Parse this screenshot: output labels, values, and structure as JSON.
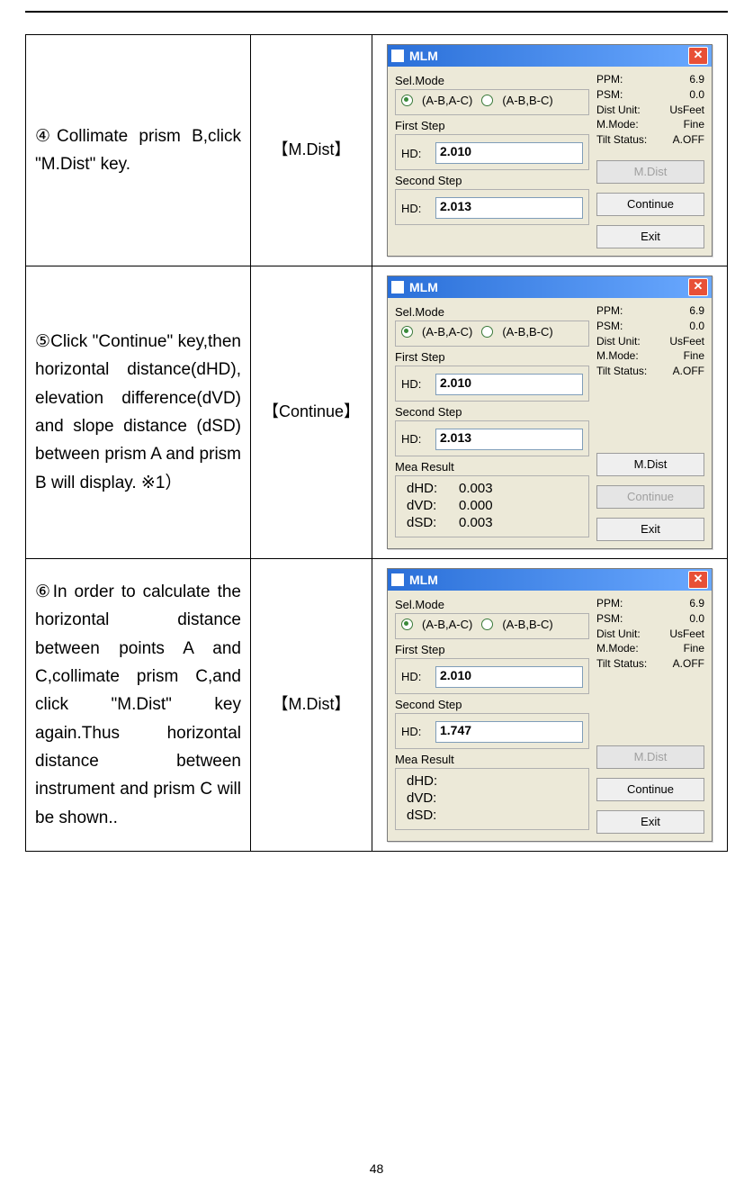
{
  "page_number": "48",
  "rows": [
    {
      "instruction": "④Collimate prism B,click \"M.Dist\" key.",
      "key": "【M.Dist】",
      "window": {
        "title": "MLM",
        "sel_mode_title": "Sel.Mode",
        "radio1_label": "(A-B,A-C)",
        "radio2_label": "(A-B,B-C)",
        "first_step_title": "First Step",
        "first_hd_label": "HD:",
        "first_hd_value": "2.010",
        "second_step_title": "Second Step",
        "second_hd_label": "HD:",
        "second_hd_value": "2.013",
        "info_ppm_label": "PPM:",
        "info_ppm_value": "6.9",
        "info_psm_label": "PSM:",
        "info_psm_value": "0.0",
        "info_dist_label": "Dist Unit:",
        "info_dist_value": "UsFeet",
        "info_mm_label": "M.Mode:",
        "info_mm_value": "Fine",
        "info_tilt_label": "Tilt Status:",
        "info_tilt_value": "A.OFF",
        "btn_mdist": "M.Dist",
        "btn_mdist_disabled": true,
        "btn_continue": "Continue",
        "btn_continue_disabled": false,
        "btn_exit": "Exit",
        "has_mea_result": false
      }
    },
    {
      "instruction": "⑤Click \"Continue\" key,then horizontal distance(dHD), elevation difference(dVD) and slope distance (dSD) between prism A and prism B will display. ※1）",
      "key": "【Continue】",
      "window": {
        "title": "MLM",
        "sel_mode_title": "Sel.Mode",
        "radio1_label": "(A-B,A-C)",
        "radio2_label": "(A-B,B-C)",
        "first_step_title": "First Step",
        "first_hd_label": "HD:",
        "first_hd_value": "2.010",
        "second_step_title": "Second Step",
        "second_hd_label": "HD:",
        "second_hd_value": "2.013",
        "info_ppm_label": "PPM:",
        "info_ppm_value": "6.9",
        "info_psm_label": "PSM:",
        "info_psm_value": "0.0",
        "info_dist_label": "Dist Unit:",
        "info_dist_value": "UsFeet",
        "info_mm_label": "M.Mode:",
        "info_mm_value": "Fine",
        "info_tilt_label": "Tilt Status:",
        "info_tilt_value": "A.OFF",
        "btn_mdist": "M.Dist",
        "btn_mdist_disabled": false,
        "btn_continue": "Continue",
        "btn_continue_disabled": true,
        "btn_exit": "Exit",
        "has_mea_result": true,
        "mea_title": "Mea Result",
        "dhd_label": "dHD:",
        "dhd_value": "0.003",
        "dvd_label": "dVD:",
        "dvd_value": "0.000",
        "dsd_label": "dSD:",
        "dsd_value": "0.003"
      }
    },
    {
      "instruction": "⑥In order to calculate the horizontal distance between points A and C,collimate prism C,and click \"M.Dist\" key again.Thus horizontal distance between instrument and prism C will be shown..",
      "key": "【M.Dist】",
      "window": {
        "title": "MLM",
        "sel_mode_title": "Sel.Mode",
        "radio1_label": "(A-B,A-C)",
        "radio2_label": "(A-B,B-C)",
        "first_step_title": "First Step",
        "first_hd_label": "HD:",
        "first_hd_value": "2.010",
        "second_step_title": "Second Step",
        "second_hd_label": "HD:",
        "second_hd_value": "1.747",
        "info_ppm_label": "PPM:",
        "info_ppm_value": "6.9",
        "info_psm_label": "PSM:",
        "info_psm_value": "0.0",
        "info_dist_label": "Dist Unit:",
        "info_dist_value": "UsFeet",
        "info_mm_label": "M.Mode:",
        "info_mm_value": "Fine",
        "info_tilt_label": "Tilt Status:",
        "info_tilt_value": "A.OFF",
        "btn_mdist": "M.Dist",
        "btn_mdist_disabled": true,
        "btn_continue": "Continue",
        "btn_continue_disabled": false,
        "btn_exit": "Exit",
        "has_mea_result": true,
        "mea_title": "Mea Result",
        "dhd_label": "dHD:",
        "dhd_value": "",
        "dvd_label": "dVD:",
        "dvd_value": "",
        "dsd_label": "dSD:",
        "dsd_value": ""
      }
    }
  ]
}
